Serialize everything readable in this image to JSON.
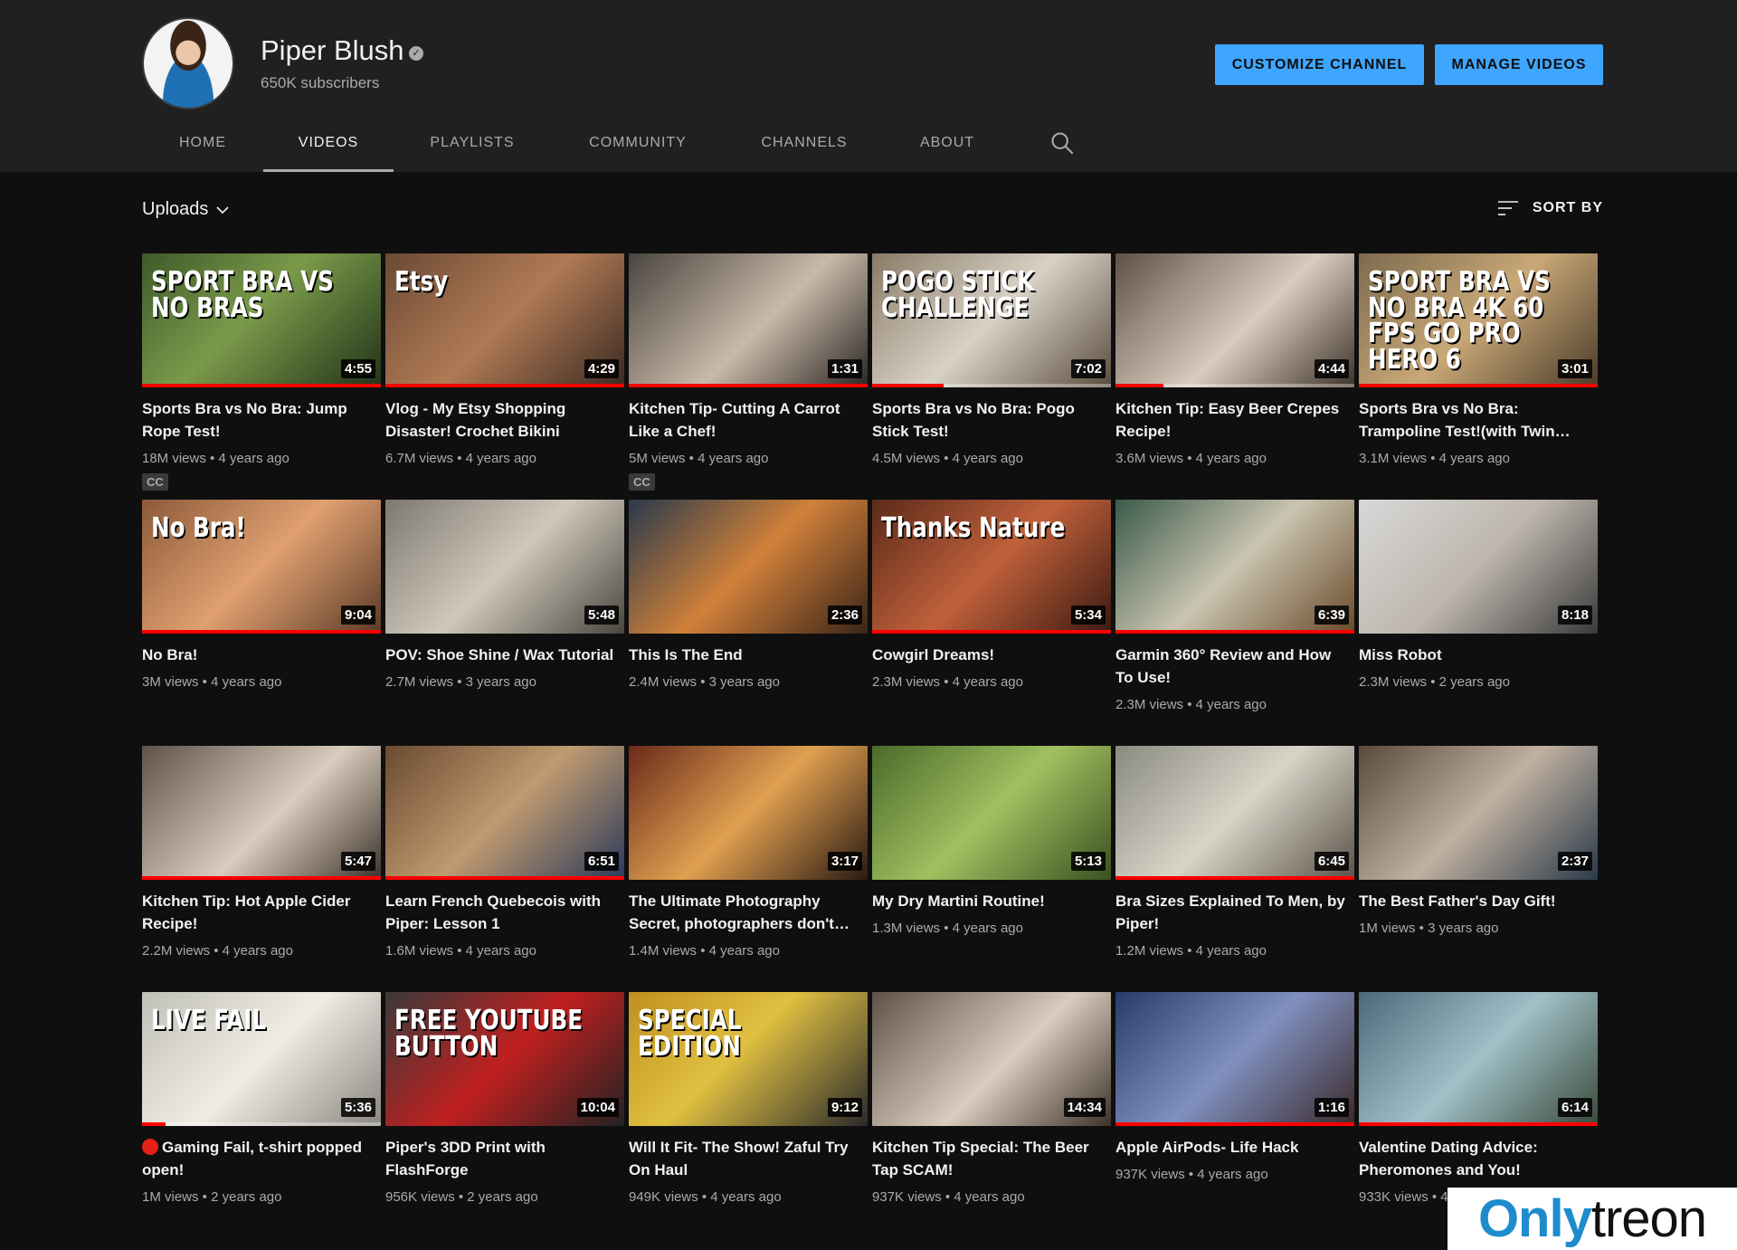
{
  "channel": {
    "name": "Piper Blush",
    "subscribers": "650K subscribers",
    "customize_label": "CUSTOMIZE CHANNEL",
    "manage_label": "MANAGE VIDEOS"
  },
  "tabs": [
    {
      "label": "HOME"
    },
    {
      "label": "VIDEOS",
      "active": true
    },
    {
      "label": "PLAYLISTS"
    },
    {
      "label": "COMMUNITY"
    },
    {
      "label": "CHANNELS"
    },
    {
      "label": "ABOUT"
    }
  ],
  "icons": {
    "search": "search-icon",
    "verified": "verified-icon",
    "sort": "sort-icon",
    "chevron": "chevron-down-icon"
  },
  "uploads_label": "Uploads",
  "sort_label": "SORT BY",
  "colors": {
    "accent": "#3ea6ff",
    "progress": "#ff0000",
    "background": "#0f0f0f",
    "header": "#202020"
  },
  "videos": [
    {
      "title": "Sports Bra vs No Bra: Jump Rope Test!",
      "meta": "18M views • 4 years ago",
      "duration": "4:55",
      "cc": "CC",
      "overlay": "SPORT BRA VS NO BRAS",
      "progress": 1.0,
      "bg": "linear-gradient(135deg,#3d5a2a,#7a9a4a 45%,#22331a)"
    },
    {
      "title": "Vlog - My Etsy Shopping Disaster! Crochet Bikini",
      "meta": "6.7M views • 4 years ago",
      "duration": "4:29",
      "overlay": "Etsy",
      "progress": 1.0,
      "bg": "linear-gradient(135deg,#6b4a35,#b07a55 50%,#3b2a22)"
    },
    {
      "title": "Kitchen Tip- Cutting A Carrot Like a Chef!",
      "meta": "5M views • 4 years ago",
      "duration": "1:31",
      "cc": "CC",
      "overlay": "",
      "progress": 1.0,
      "bg": "linear-gradient(135deg,#4a4540,#c9b9a8 55%,#2a2624)"
    },
    {
      "title": "Sports Bra vs No Bra: Pogo Stick Test!",
      "meta": "4.5M views • 4 years ago",
      "duration": "7:02",
      "overlay": "POGO STICK CHALLENGE",
      "progress": 0.3,
      "bg": "linear-gradient(135deg,#8a7a66,#d8d2c6 50%,#5a4c3e)"
    },
    {
      "title": "Kitchen Tip: Easy Beer Crepes Recipe!",
      "meta": "3.6M views • 4 years ago",
      "duration": "4:44",
      "overlay": "",
      "progress": 0.2,
      "bg": "linear-gradient(135deg,#5e5248,#d9cbbd 55%,#3d332b)"
    },
    {
      "title": "Sports Bra vs No Bra: Trampoline Test!(with Twin…",
      "meta": "3.1M views • 4 years ago",
      "duration": "3:01",
      "overlay": "SPORT BRA VS NO BRA 4K 60 FPS GO PRO HERO 6",
      "progress": 1.0,
      "bg": "linear-gradient(135deg,#7c6a4e,#c9a877 50%,#4a3b2a)"
    },
    {
      "title": "No Bra!",
      "meta": "3M views • 4 years ago",
      "duration": "9:04",
      "overlay": "No Bra!",
      "progress": 1.0,
      "bg": "linear-gradient(135deg,#8c5a3a,#e0a070 50%,#5a3a28)"
    },
    {
      "title": "POV: Shoe Shine / Wax Tutorial",
      "meta": "2.7M views • 3 years ago",
      "duration": "5:48",
      "overlay": "",
      "progress": 0.0,
      "bg": "linear-gradient(135deg,#7d7870,#cfc8bb 50%,#4a463f)"
    },
    {
      "title": "This Is The End",
      "meta": "2.4M views • 3 years ago",
      "duration": "2:36",
      "overlay": "",
      "progress": 0.0,
      "bg": "linear-gradient(135deg,#2a3a4a,#d0803a 50%,#3a2418)"
    },
    {
      "title": "Cowgirl Dreams!",
      "meta": "2.3M views • 4 years ago",
      "duration": "5:34",
      "overlay": "Thanks Nature",
      "progress": 1.0,
      "bg": "linear-gradient(135deg,#5a2a1a,#c0603a 50%,#3a1a12)"
    },
    {
      "title": "Garmin 360° Review and How To Use!",
      "meta": "2.3M views • 4 years ago",
      "duration": "6:39",
      "overlay": "",
      "progress": 1.0,
      "bg": "linear-gradient(135deg,#3a5a4a,#c9c4b0 50%,#6a4a2a)"
    },
    {
      "title": "Miss Robot",
      "meta": "2.3M views • 2 years ago",
      "duration": "8:18",
      "overlay": "",
      "progress": 0.0,
      "bg": "linear-gradient(135deg,#d8d8d8,#bdb6ad 50%,#3a3a3a)"
    },
    {
      "title": "Kitchen Tip: Hot Apple Cider Recipe!",
      "meta": "2.2M views • 4 years ago",
      "duration": "5:47",
      "overlay": "",
      "progress": 1.0,
      "bg": "linear-gradient(135deg,#5e5248,#d9cbbd 55%,#3d332b)"
    },
    {
      "title": "Learn French Quebecois with Piper: Lesson 1",
      "meta": "1.6M views • 4 years ago",
      "duration": "6:51",
      "overlay": "",
      "progress": 1.0,
      "bg": "linear-gradient(135deg,#6a4a30,#c09a70 50%,#2a3a5a)"
    },
    {
      "title": "The Ultimate Photography Secret, photographers don't…",
      "meta": "1.4M views • 4 years ago",
      "duration": "3:17",
      "overlay": "",
      "progress": 0.0,
      "bg": "linear-gradient(135deg,#6a2a1a,#e0a050 50%,#2a1a12)"
    },
    {
      "title": "My Dry Martini Routine!",
      "meta": "1.3M views • 4 years ago",
      "duration": "5:13",
      "overlay": "",
      "progress": 0.0,
      "bg": "linear-gradient(135deg,#4a6a2a,#a0c060 50%,#3a5020)"
    },
    {
      "title": "Bra Sizes Explained To Men, by Piper!",
      "meta": "1.2M views • 4 years ago",
      "duration": "6:45",
      "overlay": "",
      "progress": 1.0,
      "bg": "linear-gradient(135deg,#8a8a80,#d8d4c8 50%,#5a5248)"
    },
    {
      "title": "The Best Father's Day Gift!",
      "meta": "1M views • 3 years ago",
      "duration": "2:37",
      "overlay": "",
      "progress": 0.0,
      "bg": "linear-gradient(135deg,#5a4a3a,#c0b0a0 50%,#2a3a4a)"
    },
    {
      "title": "Gaming Fail, t-shirt popped open!",
      "meta": "1M views • 2 years ago",
      "duration": "5:36",
      "overlay": "LIVE FAIL",
      "live": true,
      "progress": 0.1,
      "bg": "linear-gradient(135deg,#c0c0b8,#f0ece4 50%,#8a8680)"
    },
    {
      "title": "Piper's 3DD Print with FlashForge",
      "meta": "956K views • 2 years ago",
      "duration": "10:04",
      "overlay": "FREE YOUTUBE BUTTON",
      "progress": 0.0,
      "bg": "linear-gradient(135deg,#3a3a3a,#c02020 50%,#222222)"
    },
    {
      "title": "Will It Fit- The Show! Zaful Try On Haul",
      "meta": "949K views • 4 years ago",
      "duration": "9:12",
      "overlay": "SPECIAL EDITION",
      "progress": 0.0,
      "bg": "linear-gradient(135deg,#c09020,#e0c040 45%,#2a2a2a)"
    },
    {
      "title": "Kitchen Tip Special: The Beer Tap SCAM!",
      "meta": "937K views • 4 years ago",
      "duration": "14:34",
      "overlay": "",
      "progress": 0.0,
      "bg": "linear-gradient(135deg,#5e5248,#d9cbbd 55%,#3d332b)"
    },
    {
      "title": "Apple AirPods- Life Hack",
      "meta": "937K views • 4 years ago",
      "duration": "1:16",
      "overlay": "",
      "progress": 1.0,
      "bg": "linear-gradient(135deg,#2a3a6a,#8090c0 50%,#3a2a2a)"
    },
    {
      "title": "Valentine Dating Advice: Pheromones and You!",
      "meta": "933K views • 4 years ago",
      "duration": "6:14",
      "overlay": "",
      "progress": 1.0,
      "bg": "linear-gradient(135deg,#4a6a7a,#a0c0c8 50%,#3a4a3a)"
    }
  ],
  "watermark": {
    "part1": "Only",
    "part2": "treon"
  }
}
